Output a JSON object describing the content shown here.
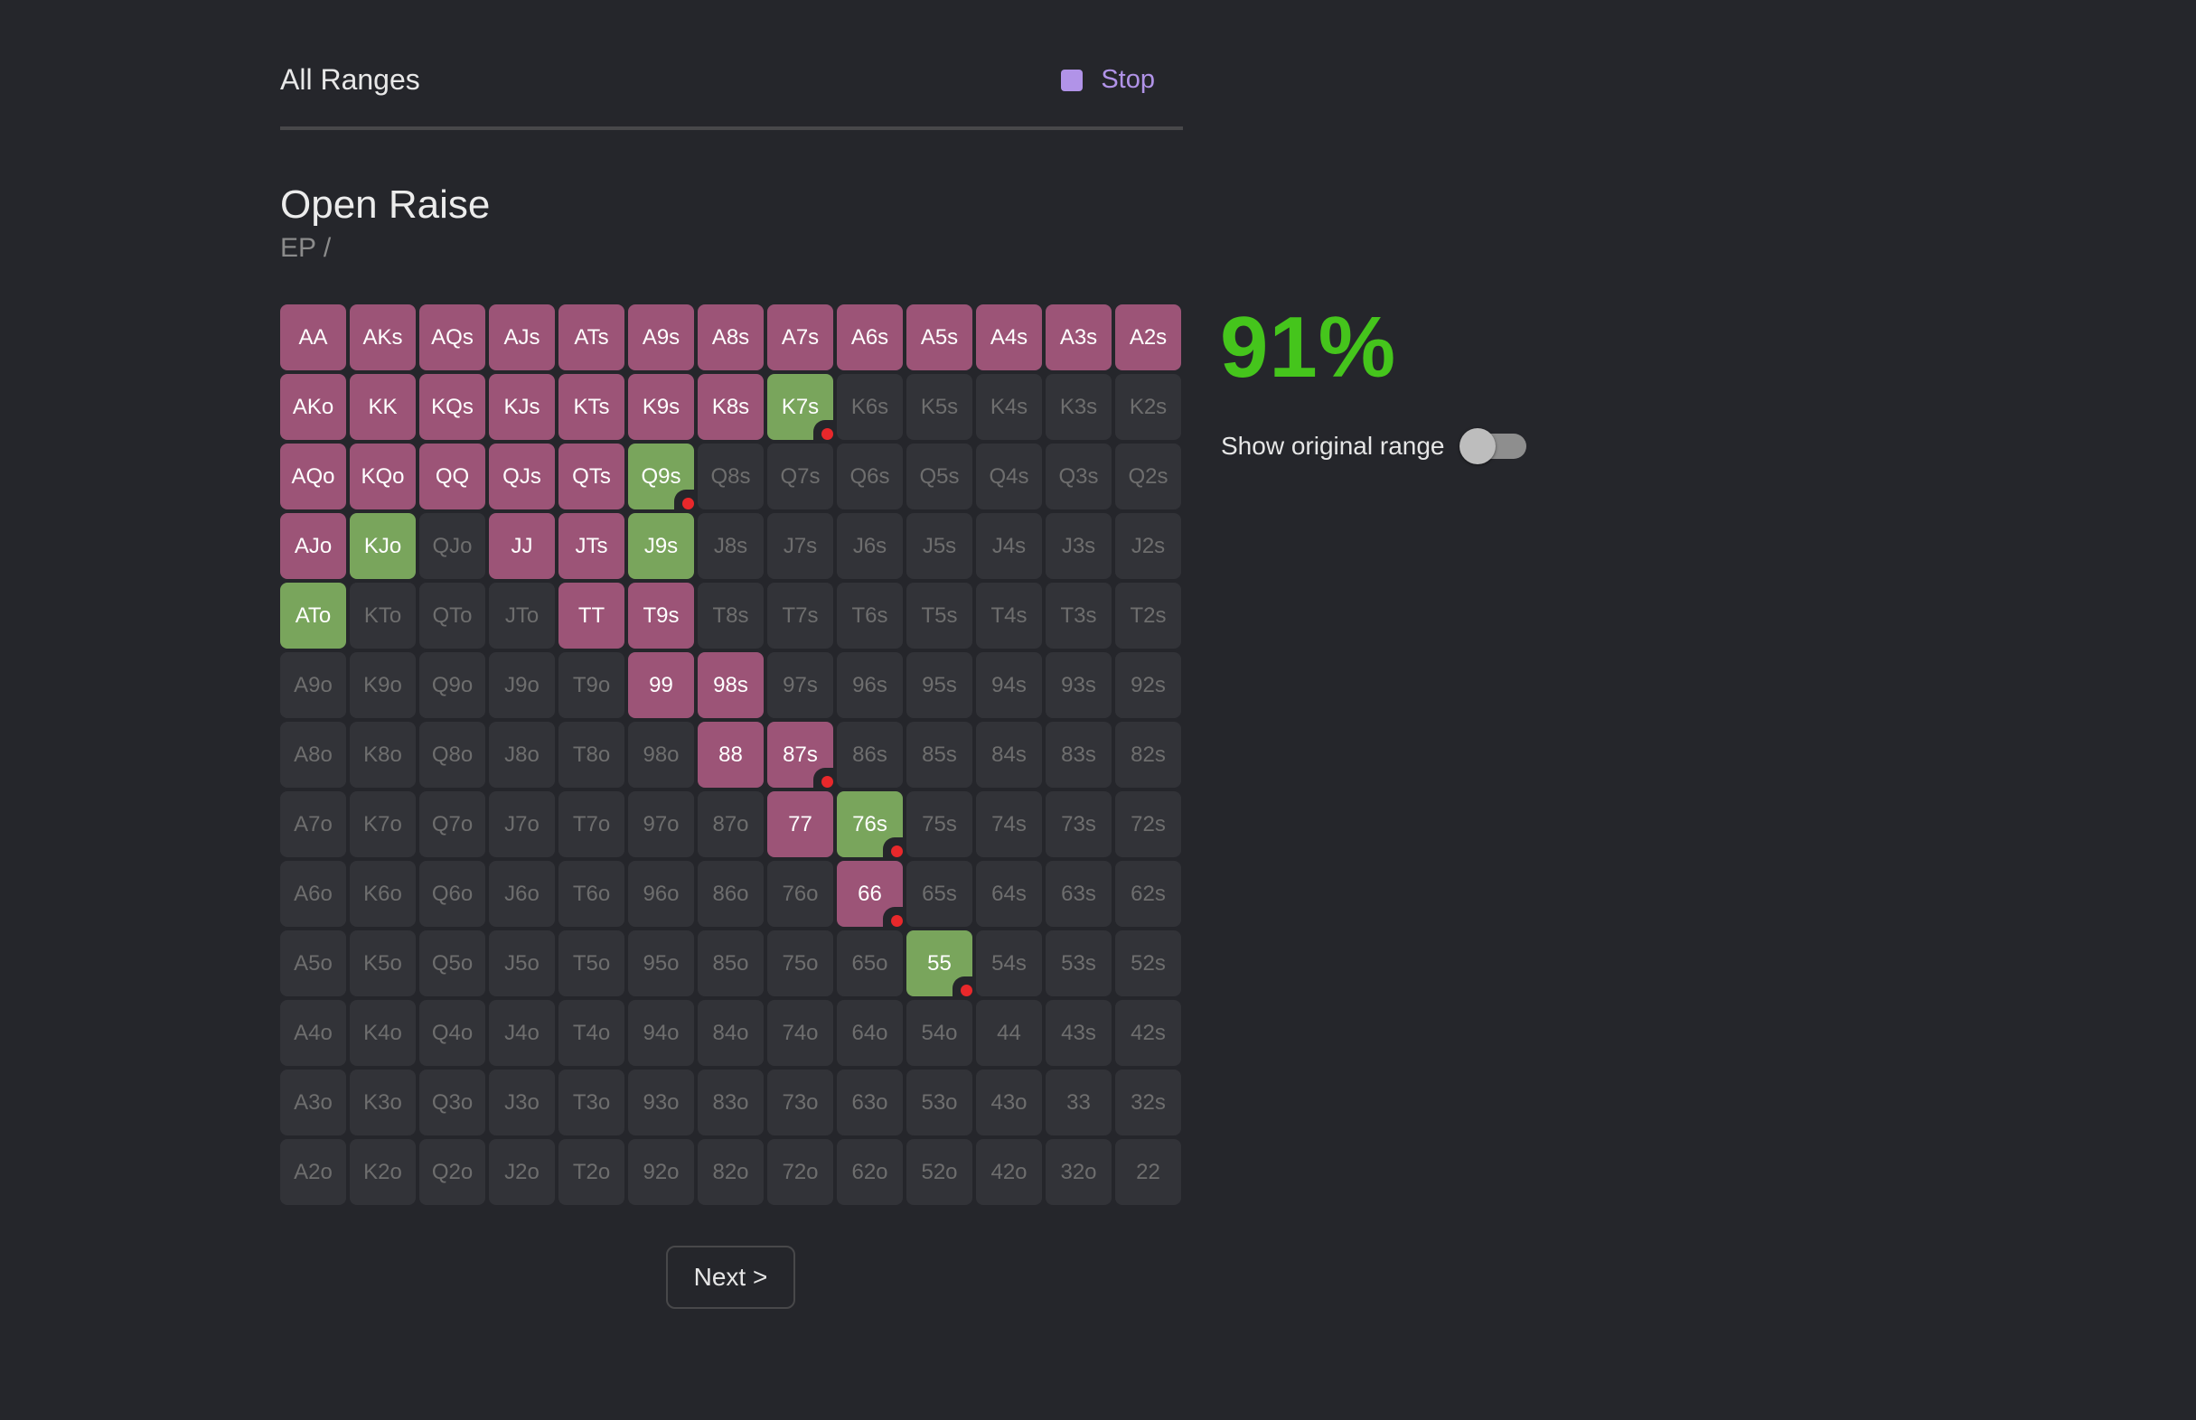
{
  "header": {
    "title": "All Ranges",
    "stop_label": "Stop"
  },
  "section": {
    "title": "Open Raise",
    "breadcrumb": "EP /"
  },
  "stats": {
    "percent": "91%",
    "show_original_label": "Show original range",
    "show_original_on": false
  },
  "colors": {
    "raise": "#9c5477",
    "correct": "#79a55c",
    "empty": "#323338",
    "mistake_dot": "#e8282b",
    "accent": "#b193e8",
    "percent": "#45c51c"
  },
  "grid": {
    "rows": [
      [
        "AA",
        "AKs",
        "AQs",
        "AJs",
        "ATs",
        "A9s",
        "A8s",
        "A7s",
        "A6s",
        "A5s",
        "A4s",
        "A3s",
        "A2s"
      ],
      [
        "AKo",
        "KK",
        "KQs",
        "KJs",
        "KTs",
        "K9s",
        "K8s",
        "K7s",
        "K6s",
        "K5s",
        "K4s",
        "K3s",
        "K2s"
      ],
      [
        "AQo",
        "KQo",
        "QQ",
        "QJs",
        "QTs",
        "Q9s",
        "Q8s",
        "Q7s",
        "Q6s",
        "Q5s",
        "Q4s",
        "Q3s",
        "Q2s"
      ],
      [
        "AJo",
        "KJo",
        "QJo",
        "JJ",
        "JTs",
        "J9s",
        "J8s",
        "J7s",
        "J6s",
        "J5s",
        "J4s",
        "J3s",
        "J2s"
      ],
      [
        "ATo",
        "KTo",
        "QTo",
        "JTo",
        "TT",
        "T9s",
        "T8s",
        "T7s",
        "T6s",
        "T5s",
        "T4s",
        "T3s",
        "T2s"
      ],
      [
        "A9o",
        "K9o",
        "Q9o",
        "J9o",
        "T9o",
        "99",
        "98s",
        "97s",
        "96s",
        "95s",
        "94s",
        "93s",
        "92s"
      ],
      [
        "A8o",
        "K8o",
        "Q8o",
        "J8o",
        "T8o",
        "98o",
        "88",
        "87s",
        "86s",
        "85s",
        "84s",
        "83s",
        "82s"
      ],
      [
        "A7o",
        "K7o",
        "Q7o",
        "J7o",
        "T7o",
        "97o",
        "87o",
        "77",
        "76s",
        "75s",
        "74s",
        "73s",
        "72s"
      ],
      [
        "A6o",
        "K6o",
        "Q6o",
        "J6o",
        "T6o",
        "96o",
        "86o",
        "76o",
        "66",
        "65s",
        "64s",
        "63s",
        "62s"
      ],
      [
        "A5o",
        "K5o",
        "Q5o",
        "J5o",
        "T5o",
        "95o",
        "85o",
        "75o",
        "65o",
        "55",
        "54s",
        "53s",
        "52s"
      ],
      [
        "A4o",
        "K4o",
        "Q4o",
        "J4o",
        "T4o",
        "94o",
        "84o",
        "74o",
        "64o",
        "54o",
        "44",
        "43s",
        "42s"
      ],
      [
        "A3o",
        "K3o",
        "Q3o",
        "J3o",
        "T3o",
        "93o",
        "83o",
        "73o",
        "63o",
        "53o",
        "43o",
        "33",
        "32s"
      ],
      [
        "A2o",
        "K2o",
        "Q2o",
        "J2o",
        "T2o",
        "92o",
        "82o",
        "72o",
        "62o",
        "52o",
        "42o",
        "32o",
        "22"
      ]
    ],
    "raise_hands": [
      "AA",
      "AKs",
      "AQs",
      "AJs",
      "ATs",
      "A9s",
      "A8s",
      "A7s",
      "A6s",
      "A5s",
      "A4s",
      "A3s",
      "A2s",
      "AKo",
      "KK",
      "KQs",
      "KJs",
      "KTs",
      "K9s",
      "K8s",
      "AQo",
      "KQo",
      "QQ",
      "QJs",
      "QTs",
      "AJo",
      "JJ",
      "JTs",
      "TT",
      "T9s",
      "99",
      "98s",
      "88",
      "87s",
      "77",
      "66"
    ],
    "green_hands": [
      "K7s",
      "Q9s",
      "KJo",
      "J9s",
      "ATo",
      "76s",
      "55"
    ],
    "marked_hands": [
      "K7s",
      "Q9s",
      "87s",
      "76s",
      "66",
      "55"
    ]
  },
  "footer": {
    "next_label": "Next >"
  }
}
